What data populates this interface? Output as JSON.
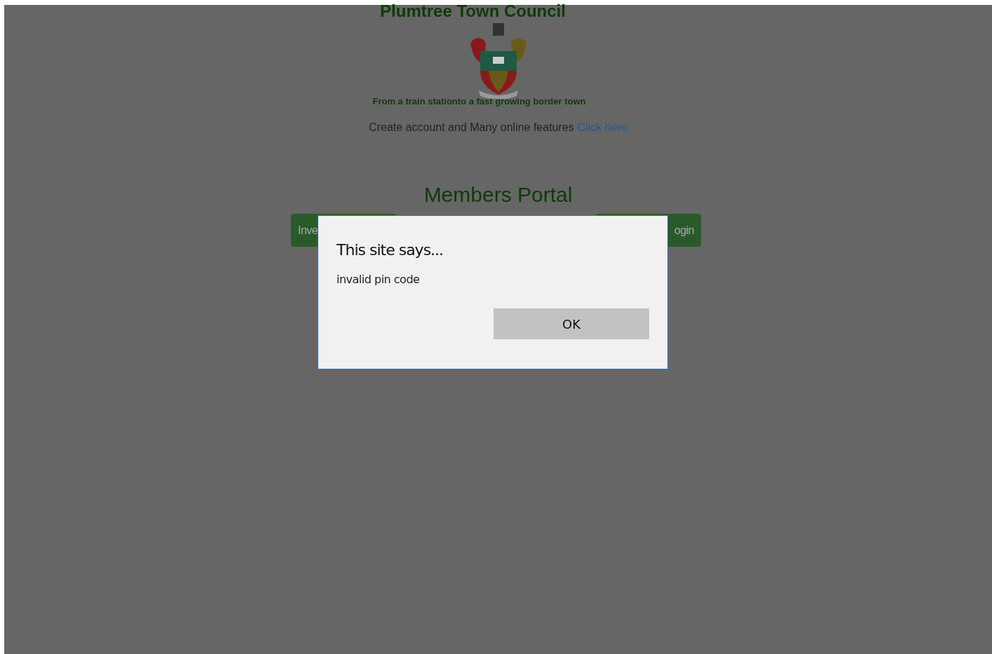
{
  "header": {
    "title": "Plumtree Town Council",
    "slogan": "From a train stationto a fast growing border town"
  },
  "promo": {
    "text": "Create account and Many online features",
    "link": "Click here"
  },
  "portal": {
    "title": "Members Portal",
    "buttons": [
      "Inve",
      "ogin"
    ]
  },
  "dialog": {
    "title": "This site says...",
    "message": "invalid pin code",
    "button": "OK"
  }
}
